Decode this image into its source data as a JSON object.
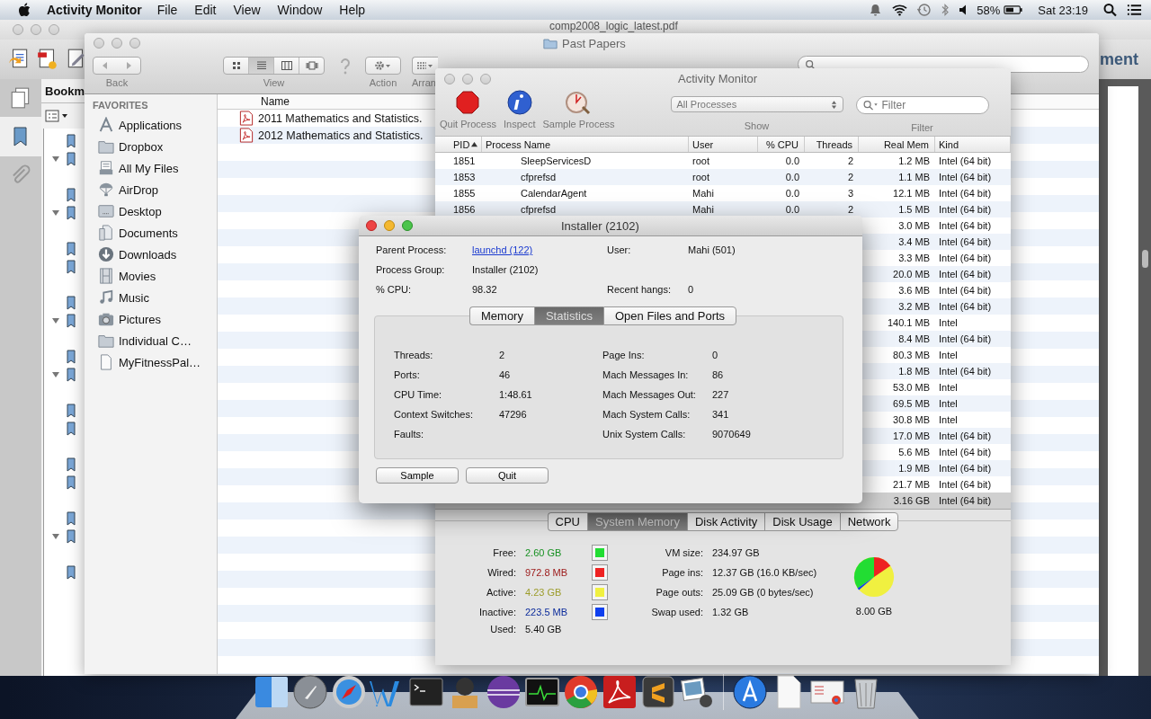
{
  "menubar": {
    "app": "Activity Monitor",
    "menus": [
      "File",
      "Edit",
      "View",
      "Window",
      "Help"
    ],
    "battery": "58%",
    "clock": "Sat 23:19"
  },
  "pdf_window": {
    "title": "comp2008_logic_latest.pdf",
    "panel_tab": "Bookm",
    "toolbar_text": "ment"
  },
  "finder": {
    "title": "Past Papers",
    "labels": {
      "back": "Back",
      "view": "View",
      "action": "Action",
      "arrange": "Arran"
    },
    "view_modes": [
      {
        "kind": "icons",
        "selected": false
      },
      {
        "kind": "list",
        "selected": true
      },
      {
        "kind": "columns",
        "selected": false
      },
      {
        "kind": "coverflow",
        "selected": false
      }
    ],
    "sidebar": {
      "heading": "FAVORITES",
      "items": [
        {
          "label": "Applications",
          "kind": "applications"
        },
        {
          "label": "Dropbox",
          "kind": "folder"
        },
        {
          "label": "All My Files",
          "kind": "files"
        },
        {
          "label": "AirDrop",
          "kind": "airdrop"
        },
        {
          "label": "Desktop",
          "kind": "desktop"
        },
        {
          "label": "Documents",
          "kind": "documents"
        },
        {
          "label": "Downloads",
          "kind": "downloads"
        },
        {
          "label": "Movies",
          "kind": "movies"
        },
        {
          "label": "Music",
          "kind": "music"
        },
        {
          "label": "Pictures",
          "kind": "pictures"
        },
        {
          "label": "Individual C…",
          "kind": "folder"
        },
        {
          "label": "MyFitnessPal…",
          "kind": "file"
        }
      ]
    },
    "column": "Name",
    "files": [
      "2011 Mathematics and Statistics.",
      "2012 Mathematics and Statistics."
    ]
  },
  "activity_monitor": {
    "title": "Activity Monitor",
    "toolbar": [
      {
        "label": "Quit Process",
        "kind": "quit"
      },
      {
        "label": "Inspect",
        "kind": "inspect"
      },
      {
        "label": "Sample Process",
        "kind": "sample"
      }
    ],
    "show": {
      "value": "All Processes",
      "label": "Show"
    },
    "filter": {
      "placeholder": "Filter",
      "label": "Filter"
    },
    "columns": [
      "PID",
      "Process Name",
      "User",
      "% CPU",
      "Threads",
      "Real Mem",
      "Kind"
    ],
    "rows": [
      {
        "pid": "1851",
        "name": "SleepServicesD",
        "user": "root",
        "cpu": "0.0",
        "threads": "2",
        "mem": "1.2 MB",
        "kind": "Intel (64 bit)",
        "selected": false
      },
      {
        "pid": "1853",
        "name": "cfprefsd",
        "user": "root",
        "cpu": "0.0",
        "threads": "2",
        "mem": "1.1 MB",
        "kind": "Intel (64 bit)",
        "selected": false
      },
      {
        "pid": "1855",
        "name": "CalendarAgent",
        "user": "Mahi",
        "cpu": "0.0",
        "threads": "3",
        "mem": "12.1 MB",
        "kind": "Intel (64 bit)",
        "selected": false
      },
      {
        "pid": "1856",
        "name": "cfprefsd",
        "user": "Mahi",
        "cpu": "0.0",
        "threads": "2",
        "mem": "1.5 MB",
        "kind": "Intel (64 bit)",
        "selected": false
      },
      {
        "mem": "3.0 MB",
        "kind": "Intel (64 bit)",
        "selected": false
      },
      {
        "mem": "3.4 MB",
        "kind": "Intel (64 bit)",
        "selected": false
      },
      {
        "mem": "3.3 MB",
        "kind": "Intel (64 bit)",
        "selected": false
      },
      {
        "mem": "20.0 MB",
        "kind": "Intel (64 bit)",
        "selected": false
      },
      {
        "mem": "3.6 MB",
        "kind": "Intel (64 bit)",
        "selected": false
      },
      {
        "mem": "3.2 MB",
        "kind": "Intel (64 bit)",
        "selected": false
      },
      {
        "mem": "140.1 MB",
        "kind": "Intel",
        "selected": false
      },
      {
        "mem": "8.4 MB",
        "kind": "Intel (64 bit)",
        "selected": false
      },
      {
        "mem": "80.3 MB",
        "kind": "Intel",
        "selected": false
      },
      {
        "mem": "1.8 MB",
        "kind": "Intel (64 bit)",
        "selected": false
      },
      {
        "mem": "53.0 MB",
        "kind": "Intel",
        "selected": false
      },
      {
        "mem": "69.5 MB",
        "kind": "Intel",
        "selected": false
      },
      {
        "mem": "30.8 MB",
        "kind": "Intel",
        "selected": false
      },
      {
        "mem": "17.0 MB",
        "kind": "Intel (64 bit)",
        "selected": false
      },
      {
        "mem": "5.6 MB",
        "kind": "Intel (64 bit)",
        "selected": false
      },
      {
        "mem": "1.9 MB",
        "kind": "Intel (64 bit)",
        "selected": false
      },
      {
        "mem": "21.7 MB",
        "kind": "Intel (64 bit)",
        "selected": false
      },
      {
        "mem": "3.16 GB",
        "kind": "Intel (64 bit)",
        "selected": true
      }
    ],
    "tabs": [
      {
        "label": "CPU",
        "selected": false
      },
      {
        "label": "System Memory",
        "selected": true
      },
      {
        "label": "Disk Activity",
        "selected": false
      },
      {
        "label": "Disk Usage",
        "selected": false
      },
      {
        "label": "Network",
        "selected": false
      }
    ],
    "memory": [
      {
        "label": "Free:",
        "value": "2.60 GB",
        "color": "#22dd33"
      },
      {
        "label": "Wired:",
        "value": "972.8 MB",
        "color": "#ee2222"
      },
      {
        "label": "Active:",
        "value": "4.23 GB",
        "color": "#f0f040"
      },
      {
        "label": "Inactive:",
        "value": "223.5 MB",
        "color": "#1040ee"
      }
    ],
    "used": {
      "label": "Used:",
      "value": "5.40 GB"
    },
    "vm": [
      {
        "label": "VM size:",
        "value": "234.97 GB"
      },
      {
        "label": "Page ins:",
        "value": "12.37 GB (16.0 KB/sec)"
      },
      {
        "label": "Page outs:",
        "value": "25.09 GB (0 bytes/sec)"
      },
      {
        "label": "Swap used:",
        "value": "1.32 GB"
      }
    ],
    "total": "8.00 GB"
  },
  "inspector": {
    "title": "Installer (2102)",
    "info": [
      [
        {
          "label": "Parent Process:",
          "value": "launchd (122)",
          "link": true
        },
        {
          "label": "User:",
          "value": "Mahi (501)",
          "link": false
        }
      ],
      [
        {
          "label": "Process Group:",
          "value": "Installer (2102)",
          "link": false
        }
      ],
      [
        {
          "label": "% CPU:",
          "value": "98.32",
          "link": false
        },
        {
          "label": "Recent hangs:",
          "value": "0",
          "link": false
        }
      ]
    ],
    "tabs": [
      {
        "label": "Memory",
        "selected": false
      },
      {
        "label": "Statistics",
        "selected": true
      },
      {
        "label": "Open Files and Ports",
        "selected": false
      }
    ],
    "stats_left": [
      {
        "label": "Threads:",
        "value": "2"
      },
      {
        "label": "Ports:",
        "value": "46"
      },
      {
        "label": "CPU Time:",
        "value": "1:48.61"
      },
      {
        "label": "Context Switches:",
        "value": "47296"
      },
      {
        "label": "Faults:"
      }
    ],
    "stats_right": [
      {
        "label": "Page Ins:",
        "value": "0"
      },
      {
        "label": "Mach Messages In:",
        "value": "86"
      },
      {
        "label": "Mach Messages Out:",
        "value": "227"
      },
      {
        "label": "Mach System Calls:",
        "value": "341"
      },
      {
        "label": "Unix System Calls:",
        "value": "9070649"
      }
    ],
    "buttons": [
      "Sample",
      "Quit"
    ]
  }
}
